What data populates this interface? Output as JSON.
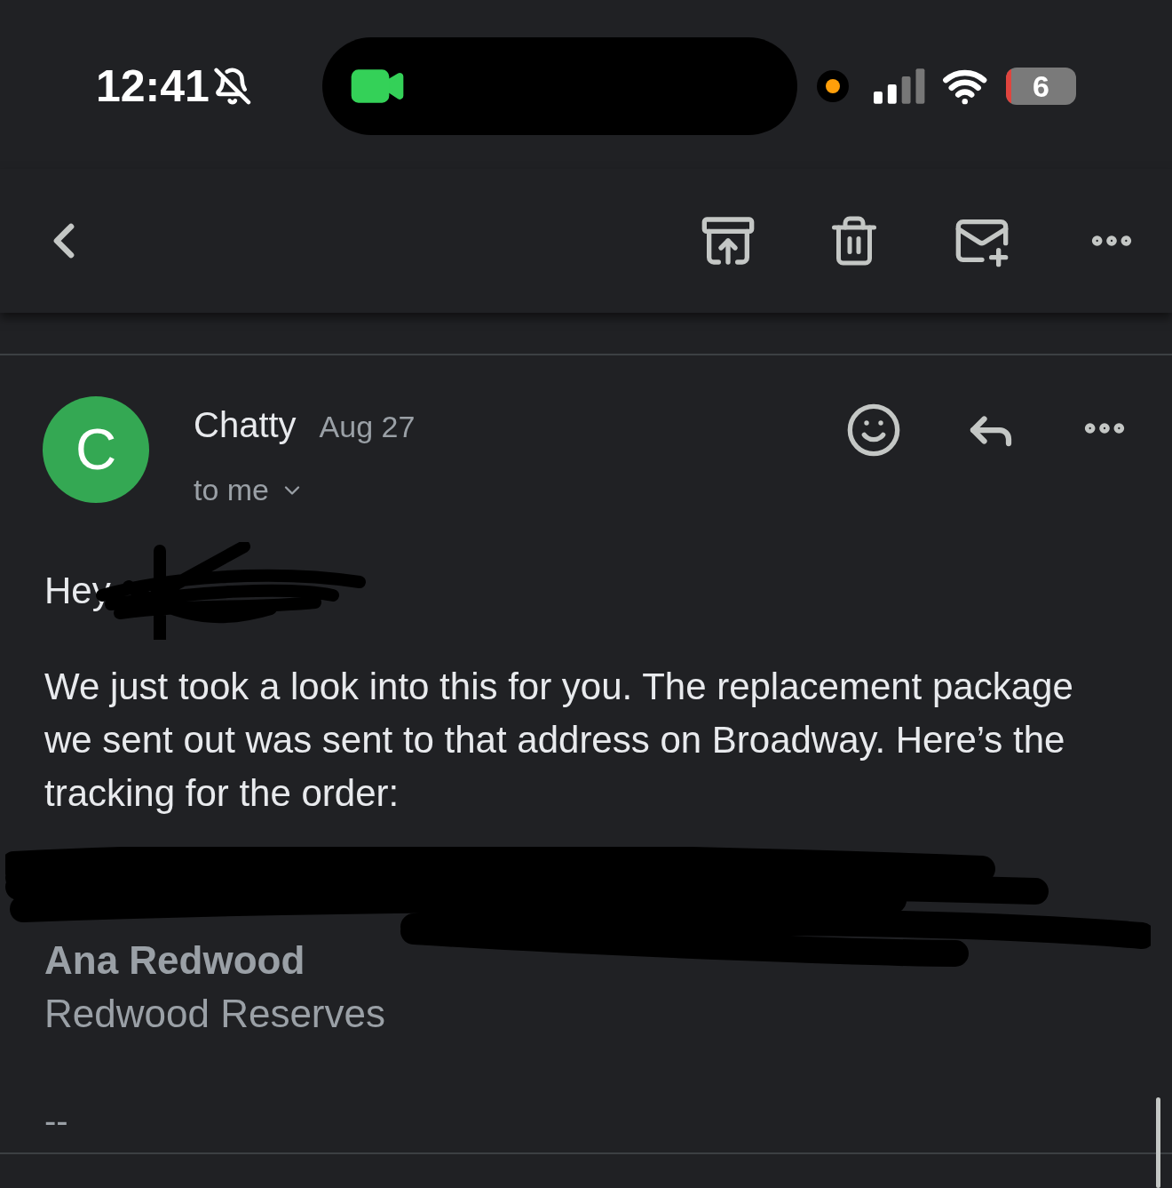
{
  "status_bar": {
    "time": "12:41",
    "silent": true,
    "battery": "6"
  },
  "message": {
    "sender": "Chatty",
    "avatar_letter": "C",
    "date": "Aug 27",
    "recipient": "to me"
  },
  "body": {
    "greeting": "Hey",
    "paragraph": "We just took a look into this for you. The replacement package we sent out was sent to that address on Broadway. Here’s the tracking for the order:",
    "signature_name": "Ana Redwood",
    "signature_company": "Redwood Reserves",
    "separator": "--"
  }
}
